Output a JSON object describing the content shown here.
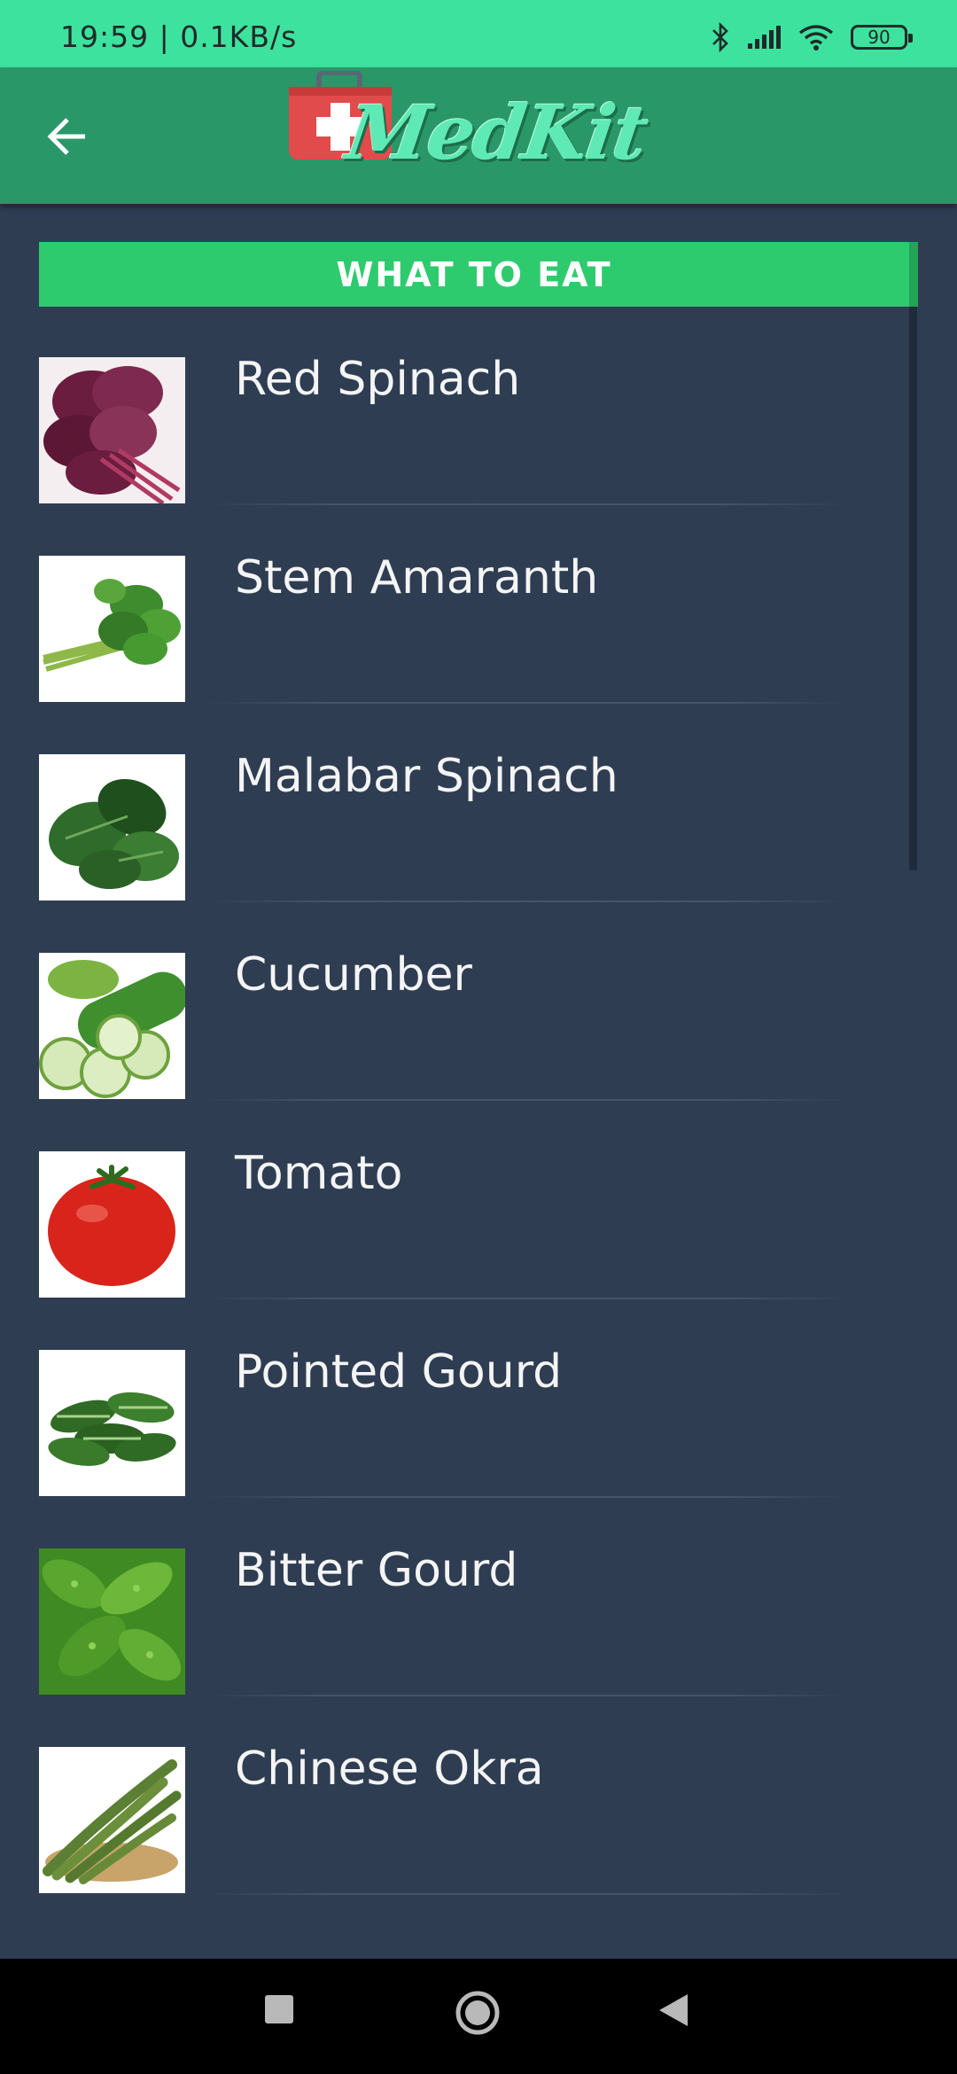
{
  "status_bar": {
    "time": "19:59 | 0.1KB/s",
    "battery": "90",
    "icons": [
      "bluetooth-icon",
      "signal-icon",
      "wifi-icon",
      "battery-icon"
    ]
  },
  "app_bar": {
    "back_icon": "back-arrow-icon",
    "logo_text": "MedKit",
    "logo_icon": "medical-kit-icon"
  },
  "section": {
    "title": "WHAT TO EAT"
  },
  "foods": [
    {
      "name": "Red Spinach",
      "image": "red-spinach"
    },
    {
      "name": "Stem Amaranth",
      "image": "stem-amaranth"
    },
    {
      "name": "Malabar Spinach",
      "image": "malabar-spinach"
    },
    {
      "name": "Cucumber",
      "image": "cucumber"
    },
    {
      "name": "Tomato",
      "image": "tomato"
    },
    {
      "name": "Pointed Gourd",
      "image": "pointed-gourd"
    },
    {
      "name": "Bitter Gourd",
      "image": "bitter-gourd"
    },
    {
      "name": "Chinese Okra",
      "image": "chinese-okra"
    }
  ],
  "nav_bar": {
    "icons": [
      "recents-square-icon",
      "home-circle-icon",
      "back-triangle-icon"
    ]
  },
  "colors": {
    "status_bar": "#3de29e",
    "app_bar": "#2a9768",
    "background": "#2e3d52",
    "section_header": "#2ecb6e"
  }
}
